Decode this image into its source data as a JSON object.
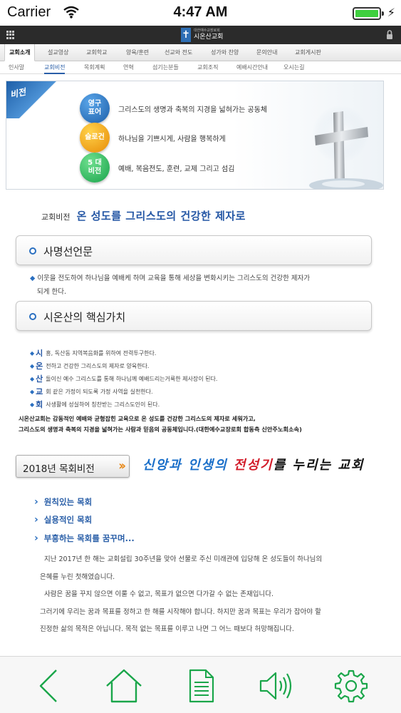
{
  "status_bar": {
    "carrier": "Carrier",
    "time": "4:47 AM"
  },
  "site_header": {
    "logo_subtitle": "대한예수교장로회",
    "logo_title": "시온산교회"
  },
  "main_menu": {
    "items": [
      "교회소개",
      "설교영상",
      "교회학교",
      "양육/훈련",
      "선교와 전도",
      "성가와 찬양",
      "문의안내",
      "교회게시판"
    ],
    "active_index": 0
  },
  "sub_menu": {
    "items": [
      "인사말",
      "교회비전",
      "목회계획",
      "연혁",
      "섬기는분들",
      "교회조직",
      "예배시간안내",
      "오시는길"
    ],
    "active_index": 1
  },
  "vision_banner": {
    "corner_label": "비전",
    "rows": [
      {
        "badge": "영구\n표어",
        "text": "그리스도의 생명과 축복의 지경을 넓혀가는 공동체"
      },
      {
        "badge": "슬로건",
        "text": "하나님을 기쁘시게, 사람을 행복하게"
      },
      {
        "badge": "5 대\n비전",
        "text": "예배, 복음전도, 훈련, 교제 그리고 섬김"
      }
    ]
  },
  "page_title": {
    "tag": "교회비전",
    "headline": "온 성도를 그리스도의 건강한 제자로"
  },
  "mission": {
    "heading": "사명선언문",
    "text_line1": "이웃을 전도하여 하나님을 예배케 하며 교육을 통해 세상을 변화시키는 그리스도의 건강한 제자가",
    "text_line2": "되게 한다."
  },
  "core_values": {
    "heading": "시온산의 핵심가치",
    "items": [
      {
        "key": "시",
        "text": "흥, 독산동 지역복음화를 위하여 전력투구한다."
      },
      {
        "key": "온",
        "text": "전하고 건강한 그리스도의 제자로 양육한다."
      },
      {
        "key": "산",
        "text": "돌이신 예수 그리스도를 통해 하나님께 예배드리는거룩한 제사장이 된다."
      },
      {
        "key": "교",
        "text": "회 같은 가정이 되도록 가정 사역을 실천한다."
      },
      {
        "key": "회",
        "text": "사생활에 성실하여 칭찬받는 그리스도인이 된다."
      }
    ]
  },
  "summary": {
    "line1": "시온산교회는 감동적인 예배와 균형잡힌 교육으로 온 성도를 건강한 그리스도의 제자로 세워가고,",
    "line2": "그리스도의 생명과 축복의 지경을 넓혀가는 사람과 믿음의 공동체입니다.(대한예수교장로회 합동측 신안주노회소속)"
  },
  "vision_2018": {
    "button_label": "2018년 목회비전",
    "slogan_part1": "신앙과 인생의 ",
    "slogan_part2": "전성기",
    "slogan_part3": "를 누리는 교회",
    "links": [
      "원칙있는 목회",
      "실용적인 목회",
      "부흥하는 목회를 꿈꾸며..."
    ],
    "paragraphs": [
      "지난 2017년 한 해는 교회설립 30주년을 맞아 선물로 주신 미래관에 입당해 온 성도들이 하나님의",
      "은혜를 누린 첫해였습니다.",
      "사람은 꿈을 꾸지 않으면 이룰 수 없고, 목표가 없으면 다가갈 수 없는 존재입니다.",
      "그러기에 우리는 꿈과 목표를 정하고 한 해를 시작해야 합니다. 하지만 꿈과 목표는 우리가 잡아야 할",
      "진정한 삶의 목적은 아닙니다. 목적 없는 목표를 이루고 나면 그 어느 때보다 허망해집니다."
    ]
  },
  "toolbar": {
    "buttons": [
      "back-icon",
      "home-icon",
      "document-icon",
      "speaker-icon",
      "settings-icon"
    ],
    "color": "#1aa64a"
  }
}
